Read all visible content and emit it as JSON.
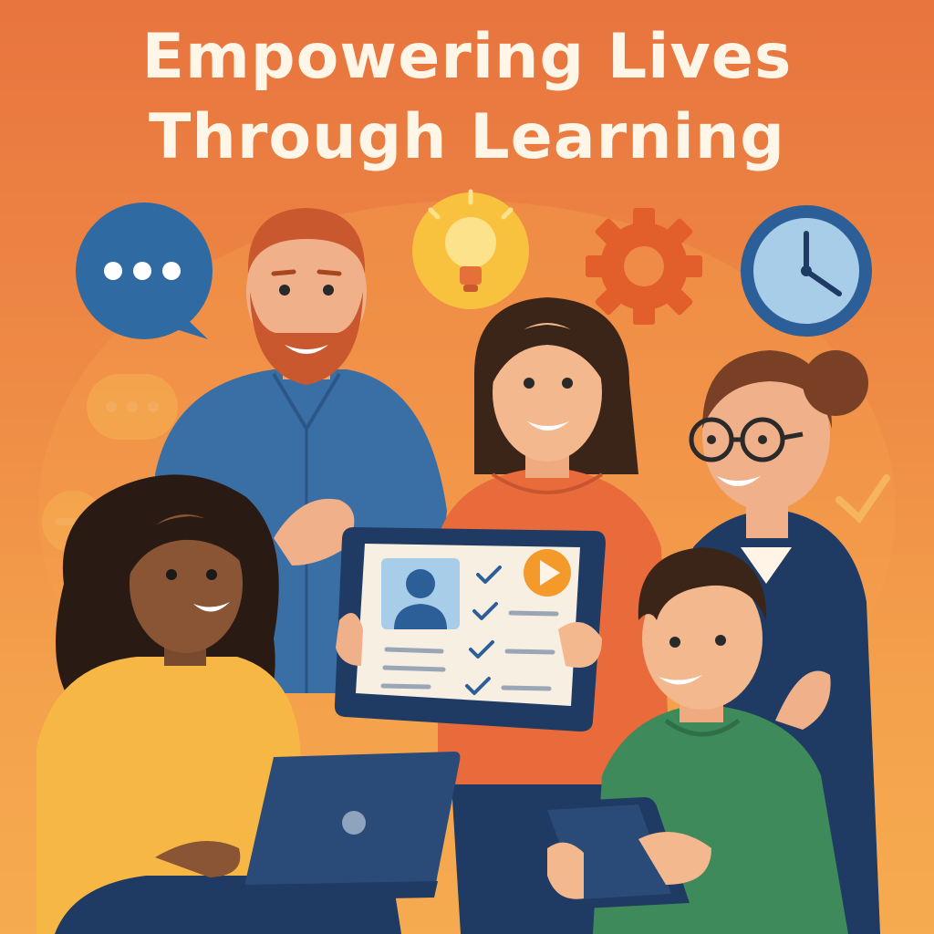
{
  "poster": {
    "title_line1": "Empowering Lives",
    "title_line2": "Through Learning"
  },
  "icons": {
    "speech": "speech-bubble-icon",
    "idea": "lightbulb-icon",
    "settings": "gear-icon",
    "time": "clock-icon",
    "play": "play-icon",
    "check": "checkmark-icon"
  },
  "colors": {
    "background_top": "#e8743e",
    "background_bottom": "#f6ab50",
    "title": "#fff6e8",
    "navy": "#1f3a63",
    "blue": "#3b73a8",
    "yellow": "#f7c044",
    "green": "#3e8a5a"
  }
}
